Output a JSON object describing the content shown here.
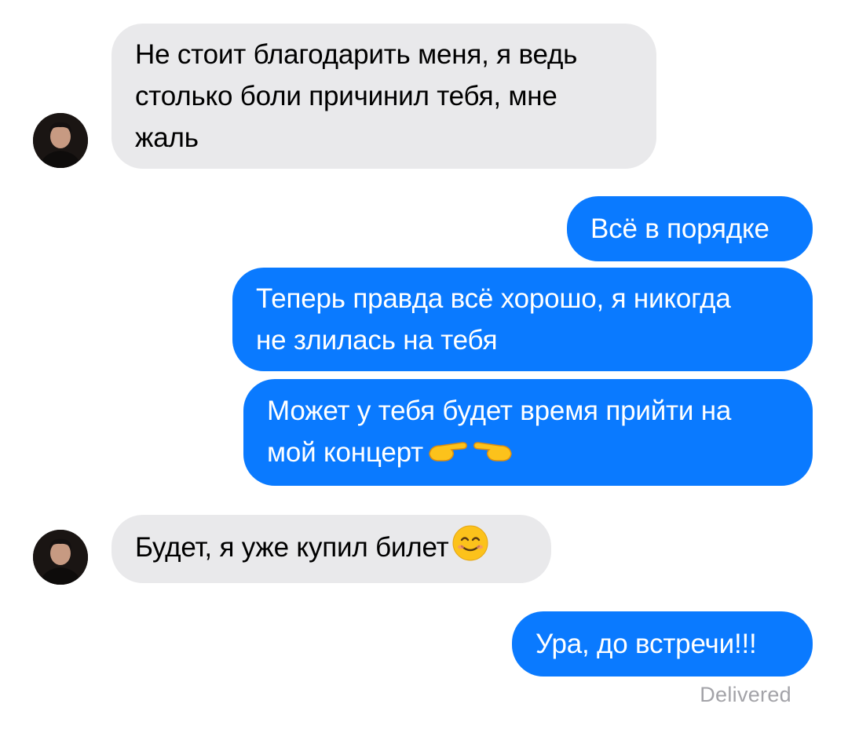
{
  "messages": [
    {
      "direction": "incoming",
      "text": "Не стоит благодарить меня, я ведь\nстолько боли причинил тебя, мне\nжаль"
    },
    {
      "direction": "outgoing",
      "text": "Всё в порядке"
    },
    {
      "direction": "outgoing",
      "text": "Теперь правда всё хорошо, я никогда\nне злилась на тебя"
    },
    {
      "direction": "outgoing",
      "text": "Может у тебя будет время прийти на\nмой концерт",
      "emoji": "pointing-fingers-emoji"
    },
    {
      "direction": "incoming",
      "text": "Будет, я уже купил билет",
      "emoji": "smiling-face-emoji"
    },
    {
      "direction": "outgoing",
      "text": "Ура, до встречи!!!"
    }
  ],
  "status": "Delivered",
  "colors": {
    "incoming_bubble": "#e9e9eb",
    "outgoing_bubble": "#0a7aff",
    "status_text": "#a3a3a8"
  }
}
